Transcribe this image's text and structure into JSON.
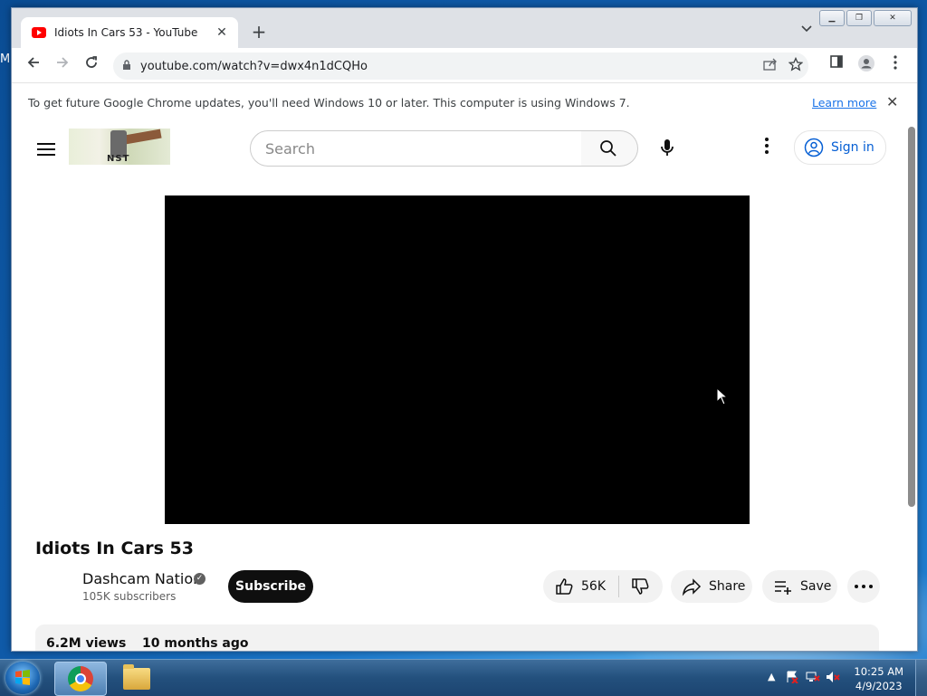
{
  "browser": {
    "tab_title": "Idiots In Cars 53 - YouTube",
    "tab_close": "✕",
    "new_tab": "+",
    "url": "youtube.com/watch?v=dwx4n1dCQHo",
    "infobar_text": "To get future Google Chrome updates, you'll need Windows 10 or later. This computer is using Windows 7.",
    "infobar_link": "Learn more",
    "infobar_close": "✕"
  },
  "youtube": {
    "search_placeholder": "Search",
    "sign_in": "Sign in",
    "logo_text": "NST",
    "video_title": "Idiots In Cars 53",
    "channel_name": "Dashcam Nation",
    "subscribers": "105K subscribers",
    "subscribe": "Subscribe",
    "likes": "56K",
    "share": "Share",
    "save": "Save",
    "views": "6.2M views",
    "age": "10 months ago"
  },
  "taskbar": {
    "time": "10:25 AM",
    "date": "4/9/2023"
  },
  "desktop": {
    "edge_char": "M"
  },
  "colors": {
    "youtube_red": "#ff0000",
    "signin_blue": "#065fd4",
    "link_blue": "#1a73e8"
  },
  "icons": [
    "youtube-favicon",
    "back-icon",
    "forward-icon",
    "reload-icon",
    "lock-icon",
    "share-page-icon",
    "star-icon",
    "sidepanel-icon",
    "profile-icon",
    "menu-icon",
    "hamburger-icon",
    "search-icon",
    "mic-icon",
    "kebab-icon",
    "account-icon",
    "verified-icon",
    "like-icon",
    "dislike-icon",
    "share-icon",
    "save-icon",
    "more-icon",
    "start-icon",
    "chrome-icon",
    "folder-icon",
    "tray-arrow-icon",
    "network-icon",
    "volume-muted-icon"
  ]
}
